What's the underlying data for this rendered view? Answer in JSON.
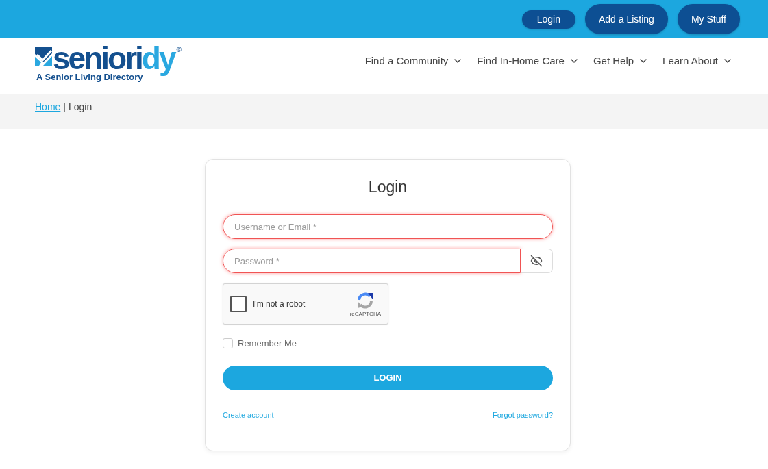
{
  "top_bar": {
    "buttons": [
      {
        "label": "Login",
        "kind": "compact"
      },
      {
        "label": "Add a Listing",
        "kind": "pill"
      },
      {
        "label": "My Stuff",
        "kind": "pill"
      }
    ]
  },
  "logo": {
    "wordmark_parts": [
      "seniori",
      "dy"
    ],
    "registered": "®",
    "tagline": "A Senior Living Directory"
  },
  "nav": [
    "Find a Community",
    "Find In-Home Care",
    "Get Help",
    "Learn About"
  ],
  "breadcrumb": {
    "link": "Home",
    "separator": "|",
    "current": "Login"
  },
  "login_form": {
    "title": "Login",
    "fields": [
      {
        "kind": "text",
        "placeholder": "Username or Email *",
        "invalid": true
      },
      {
        "kind": "password",
        "placeholder": "Password *",
        "invalid": true
      }
    ],
    "captcha": {
      "label": "I'm not a robot",
      "brand": "reCAPTCHA",
      "checked": false
    },
    "remember_me": {
      "label": "Remember Me",
      "checked": false
    },
    "submit": "LOGIN",
    "links": [
      "Create account",
      "Forgot password?"
    ]
  }
}
